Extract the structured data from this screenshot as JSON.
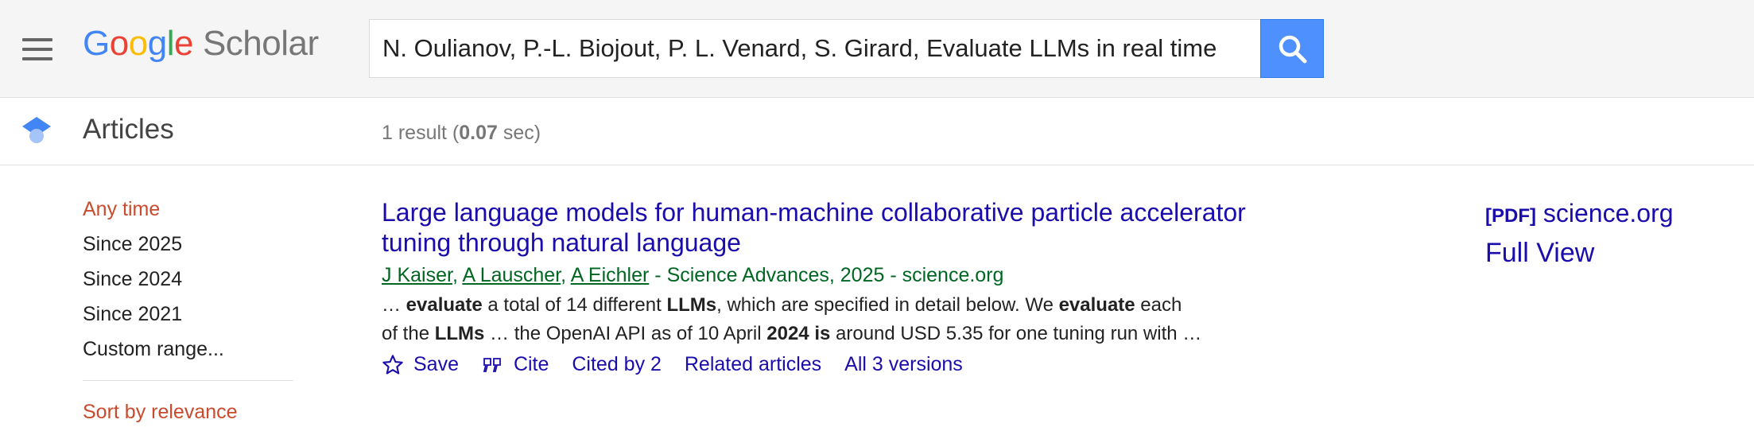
{
  "header": {
    "logo": {
      "google": [
        "G",
        "o",
        "o",
        "g",
        "l",
        "e"
      ],
      "scholar": "Scholar"
    },
    "search": {
      "value": "N. Oulianov, P.-L. Biojout, P. L. Venard, S. Girard, Evaluate LLMs in real time"
    }
  },
  "subbar": {
    "section_title": "Articles",
    "result_prefix": "1 result (",
    "result_time": "0.07",
    "result_suffix": " sec)"
  },
  "sidebar": {
    "time_filters": [
      "Any time",
      "Since 2025",
      "Since 2024",
      "Since 2021",
      "Custom range..."
    ],
    "active_time_filter": "Any time",
    "sort": "Sort by relevance"
  },
  "result": {
    "title_line1": "Large language models for human-machine collaborative particle accelerator",
    "title_line2": "tuning through natural language",
    "authors": [
      "J Kaiser",
      "A Lauscher",
      "A Eichler"
    ],
    "source": " - Science Advances, 2025 - science.org",
    "snippet_line1": [
      {
        "t": "… ",
        "b": false
      },
      {
        "t": "evaluate",
        "b": true
      },
      {
        "t": " a total of 14 different ",
        "b": false
      },
      {
        "t": "LLMs",
        "b": true
      },
      {
        "t": ", which are specified in detail below. We ",
        "b": false
      },
      {
        "t": "evaluate",
        "b": true
      },
      {
        "t": " each",
        "b": false
      }
    ],
    "snippet_line2": [
      {
        "t": "of the ",
        "b": false
      },
      {
        "t": "LLMs",
        "b": true
      },
      {
        "t": " … the OpenAI API as of 10 April ",
        "b": false
      },
      {
        "t": "2024 is",
        "b": true
      },
      {
        "t": " around USD 5.35 for one tuning run with …",
        "b": false
      }
    ],
    "actions": {
      "save": "Save",
      "cite": "Cite",
      "cited_by": "Cited by 2",
      "related": "Related articles",
      "versions": "All 3 versions"
    }
  },
  "side_links": {
    "pdf_tag": "[PDF]",
    "pdf_source": "science.org",
    "full_view": "Full View"
  },
  "colors": {
    "link": "#1a0dab",
    "green": "#006621",
    "active_filter": "#c94a2c",
    "search_button": "#4d90fe"
  }
}
